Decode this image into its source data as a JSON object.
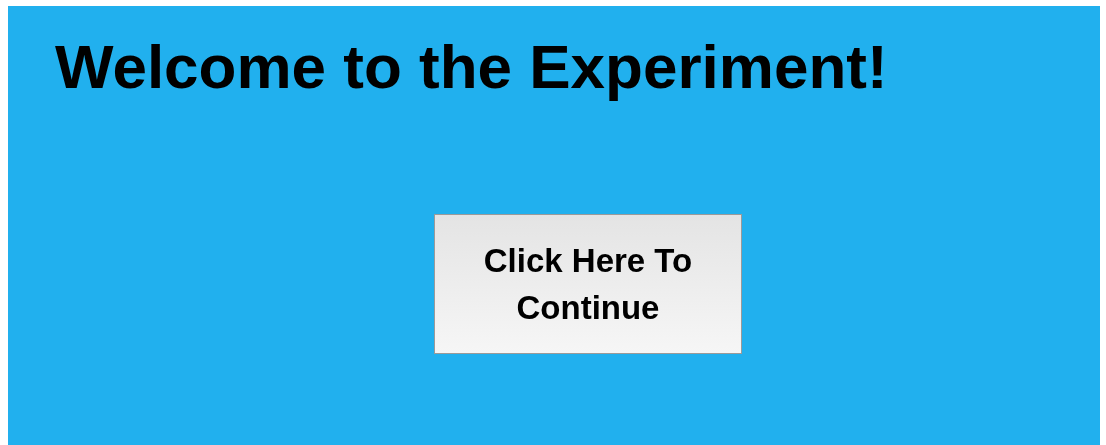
{
  "title": "Welcome to the Experiment!",
  "continue_button": {
    "label": "Click Here To Continue"
  }
}
